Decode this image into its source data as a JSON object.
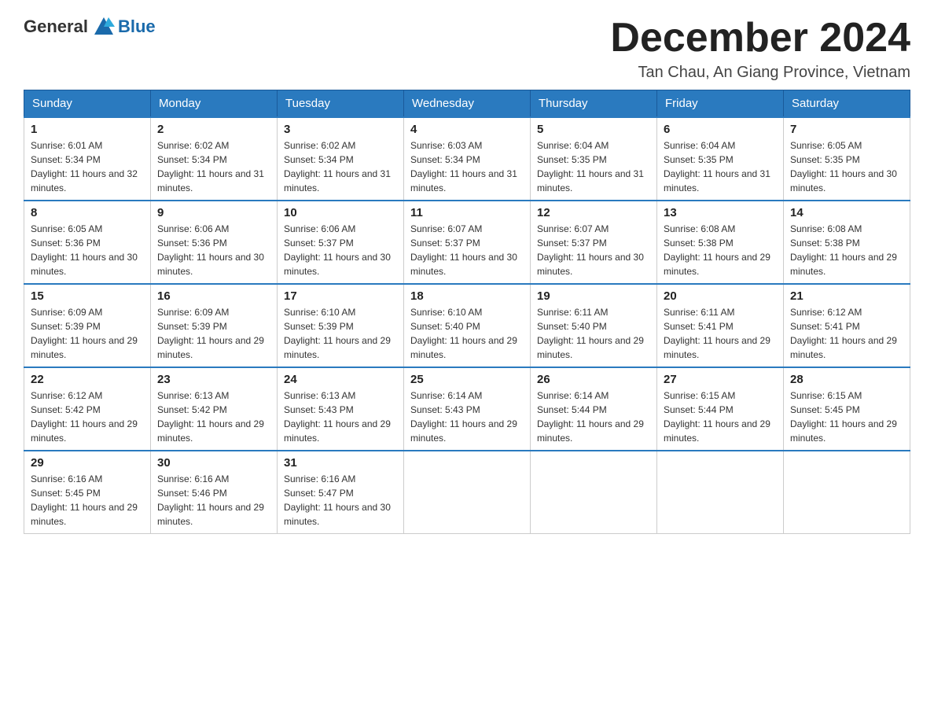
{
  "header": {
    "logo_general": "General",
    "logo_blue": "Blue",
    "month_year": "December 2024",
    "location": "Tan Chau, An Giang Province, Vietnam"
  },
  "days_of_week": [
    "Sunday",
    "Monday",
    "Tuesday",
    "Wednesday",
    "Thursday",
    "Friday",
    "Saturday"
  ],
  "weeks": [
    [
      {
        "num": "1",
        "sunrise": "6:01 AM",
        "sunset": "5:34 PM",
        "daylight": "11 hours and 32 minutes."
      },
      {
        "num": "2",
        "sunrise": "6:02 AM",
        "sunset": "5:34 PM",
        "daylight": "11 hours and 31 minutes."
      },
      {
        "num": "3",
        "sunrise": "6:02 AM",
        "sunset": "5:34 PM",
        "daylight": "11 hours and 31 minutes."
      },
      {
        "num": "4",
        "sunrise": "6:03 AM",
        "sunset": "5:34 PM",
        "daylight": "11 hours and 31 minutes."
      },
      {
        "num": "5",
        "sunrise": "6:04 AM",
        "sunset": "5:35 PM",
        "daylight": "11 hours and 31 minutes."
      },
      {
        "num": "6",
        "sunrise": "6:04 AM",
        "sunset": "5:35 PM",
        "daylight": "11 hours and 31 minutes."
      },
      {
        "num": "7",
        "sunrise": "6:05 AM",
        "sunset": "5:35 PM",
        "daylight": "11 hours and 30 minutes."
      }
    ],
    [
      {
        "num": "8",
        "sunrise": "6:05 AM",
        "sunset": "5:36 PM",
        "daylight": "11 hours and 30 minutes."
      },
      {
        "num": "9",
        "sunrise": "6:06 AM",
        "sunset": "5:36 PM",
        "daylight": "11 hours and 30 minutes."
      },
      {
        "num": "10",
        "sunrise": "6:06 AM",
        "sunset": "5:37 PM",
        "daylight": "11 hours and 30 minutes."
      },
      {
        "num": "11",
        "sunrise": "6:07 AM",
        "sunset": "5:37 PM",
        "daylight": "11 hours and 30 minutes."
      },
      {
        "num": "12",
        "sunrise": "6:07 AM",
        "sunset": "5:37 PM",
        "daylight": "11 hours and 30 minutes."
      },
      {
        "num": "13",
        "sunrise": "6:08 AM",
        "sunset": "5:38 PM",
        "daylight": "11 hours and 29 minutes."
      },
      {
        "num": "14",
        "sunrise": "6:08 AM",
        "sunset": "5:38 PM",
        "daylight": "11 hours and 29 minutes."
      }
    ],
    [
      {
        "num": "15",
        "sunrise": "6:09 AM",
        "sunset": "5:39 PM",
        "daylight": "11 hours and 29 minutes."
      },
      {
        "num": "16",
        "sunrise": "6:09 AM",
        "sunset": "5:39 PM",
        "daylight": "11 hours and 29 minutes."
      },
      {
        "num": "17",
        "sunrise": "6:10 AM",
        "sunset": "5:39 PM",
        "daylight": "11 hours and 29 minutes."
      },
      {
        "num": "18",
        "sunrise": "6:10 AM",
        "sunset": "5:40 PM",
        "daylight": "11 hours and 29 minutes."
      },
      {
        "num": "19",
        "sunrise": "6:11 AM",
        "sunset": "5:40 PM",
        "daylight": "11 hours and 29 minutes."
      },
      {
        "num": "20",
        "sunrise": "6:11 AM",
        "sunset": "5:41 PM",
        "daylight": "11 hours and 29 minutes."
      },
      {
        "num": "21",
        "sunrise": "6:12 AM",
        "sunset": "5:41 PM",
        "daylight": "11 hours and 29 minutes."
      }
    ],
    [
      {
        "num": "22",
        "sunrise": "6:12 AM",
        "sunset": "5:42 PM",
        "daylight": "11 hours and 29 minutes."
      },
      {
        "num": "23",
        "sunrise": "6:13 AM",
        "sunset": "5:42 PM",
        "daylight": "11 hours and 29 minutes."
      },
      {
        "num": "24",
        "sunrise": "6:13 AM",
        "sunset": "5:43 PM",
        "daylight": "11 hours and 29 minutes."
      },
      {
        "num": "25",
        "sunrise": "6:14 AM",
        "sunset": "5:43 PM",
        "daylight": "11 hours and 29 minutes."
      },
      {
        "num": "26",
        "sunrise": "6:14 AM",
        "sunset": "5:44 PM",
        "daylight": "11 hours and 29 minutes."
      },
      {
        "num": "27",
        "sunrise": "6:15 AM",
        "sunset": "5:44 PM",
        "daylight": "11 hours and 29 minutes."
      },
      {
        "num": "28",
        "sunrise": "6:15 AM",
        "sunset": "5:45 PM",
        "daylight": "11 hours and 29 minutes."
      }
    ],
    [
      {
        "num": "29",
        "sunrise": "6:16 AM",
        "sunset": "5:45 PM",
        "daylight": "11 hours and 29 minutes."
      },
      {
        "num": "30",
        "sunrise": "6:16 AM",
        "sunset": "5:46 PM",
        "daylight": "11 hours and 29 minutes."
      },
      {
        "num": "31",
        "sunrise": "6:16 AM",
        "sunset": "5:47 PM",
        "daylight": "11 hours and 30 minutes."
      },
      null,
      null,
      null,
      null
    ]
  ]
}
